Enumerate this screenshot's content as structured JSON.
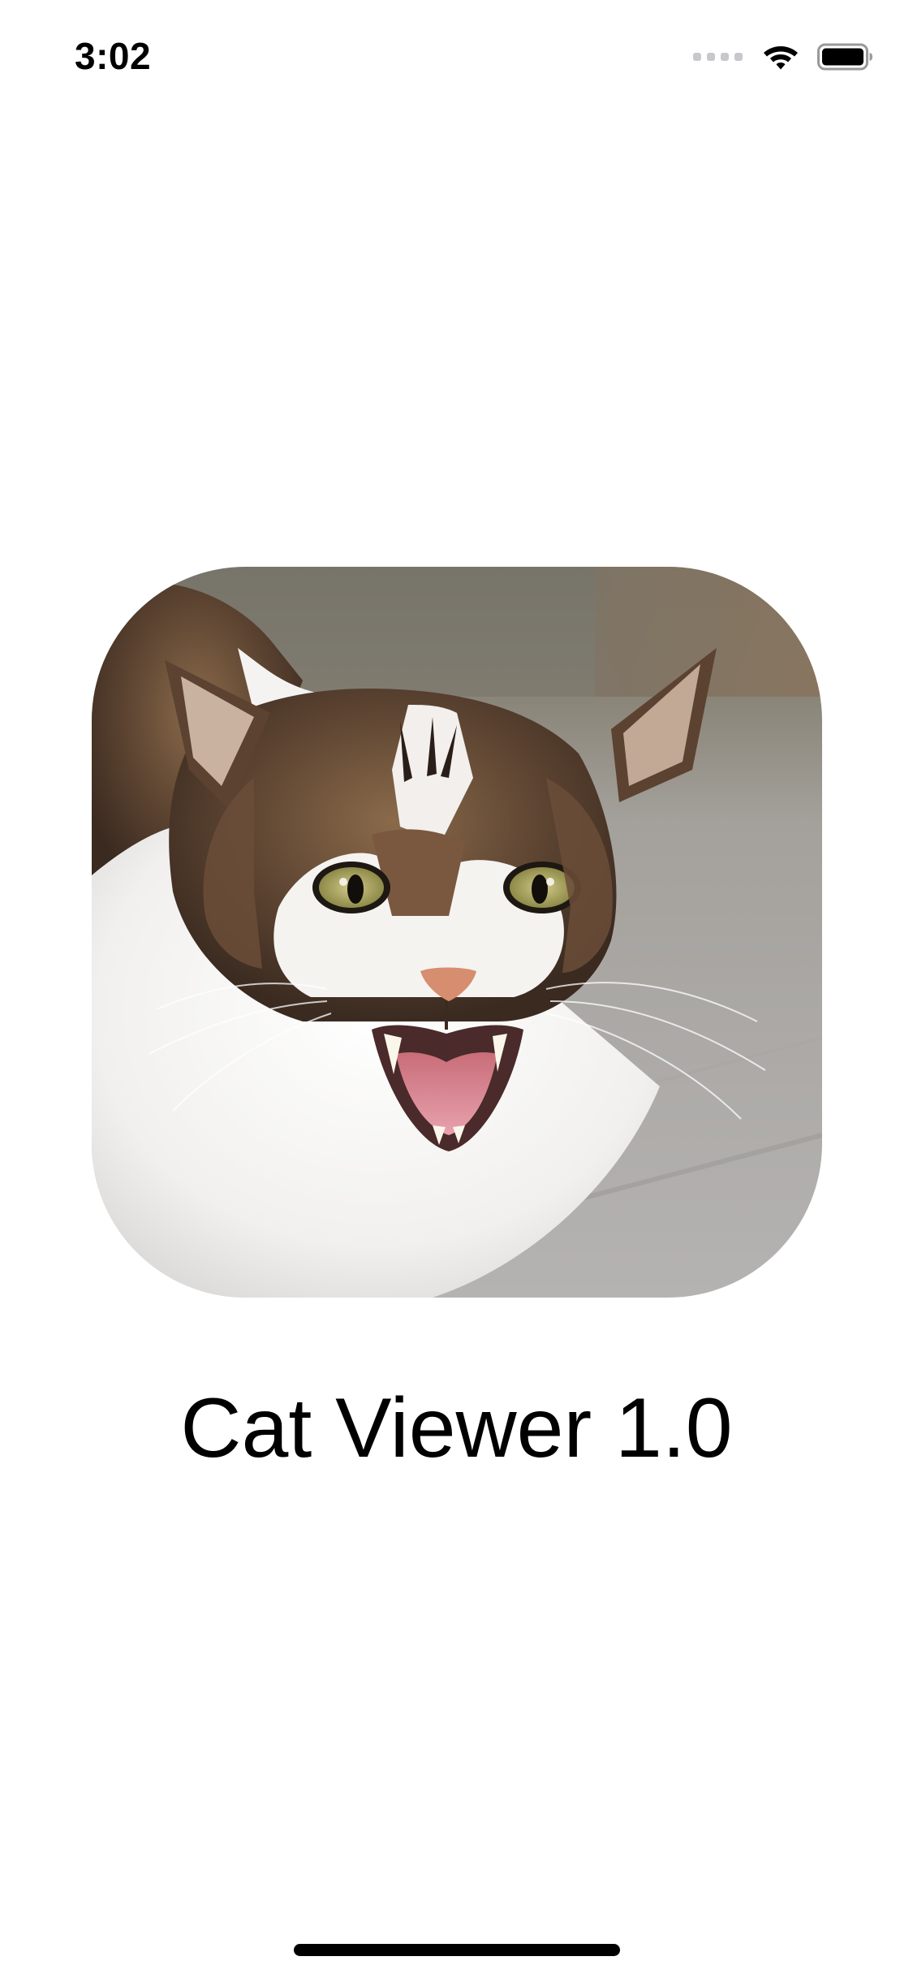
{
  "status_bar": {
    "time": "3:02",
    "icons": [
      "cellular-signal-icon",
      "wifi-icon",
      "battery-icon"
    ]
  },
  "main": {
    "artwork_icon": "cat-photo",
    "title": "Cat Viewer 1.0"
  },
  "colors": {
    "background": "#ffffff",
    "text": "#000000",
    "signal_inactive": "#c7c7cc"
  }
}
